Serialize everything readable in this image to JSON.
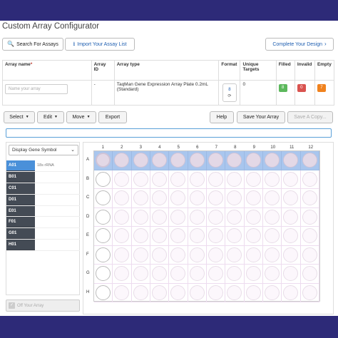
{
  "app": {
    "title": "Custom Array Configurator"
  },
  "top_actions": {
    "search_label": "Search For Assays",
    "import_label": "Import Your Assay List",
    "complete_label": "Complete Your Design"
  },
  "array_table": {
    "headers": [
      "Array name",
      "Array ID",
      "Array type",
      "Format",
      "Unique Targets",
      "Filled",
      "Invalid",
      "Empty"
    ],
    "array_name_placeholder": "Name your array",
    "array_id": "-",
    "array_type": "TaqMan Gene Expression Array Plate 0.2mL (Standard)",
    "format_value": "8",
    "unique_targets": "0",
    "filled": "8",
    "invalid": "0",
    "empty": "7",
    "colors": {
      "filled": "#5cb85c",
      "invalid": "#d9534f",
      "empty": "#f0821e"
    }
  },
  "toolbar": {
    "select_label": "Select",
    "edit_label": "Edit",
    "move_label": "Move",
    "export_label": "Export",
    "help_label": "Help",
    "save_label": "Save Your Array",
    "save_copy_label": "Save A Copy..."
  },
  "left_panel": {
    "display_select": "Display Gene Symbol",
    "rows": [
      {
        "label": "A01",
        "value": "18s rRNA"
      },
      {
        "label": "B01",
        "value": ""
      },
      {
        "label": "C01",
        "value": ""
      },
      {
        "label": "D01",
        "value": ""
      },
      {
        "label": "E01",
        "value": ""
      },
      {
        "label": "F01",
        "value": ""
      },
      {
        "label": "G01",
        "value": ""
      },
      {
        "label": "H01",
        "value": ""
      }
    ],
    "diff_button": "Off Your Array"
  },
  "plate": {
    "columns": [
      "1",
      "2",
      "3",
      "4",
      "5",
      "6",
      "7",
      "8",
      "9",
      "10",
      "11",
      "12"
    ],
    "rows": [
      "A",
      "B",
      "C",
      "D",
      "E",
      "F",
      "G",
      "H"
    ],
    "selected_row": "A"
  },
  "colors": {
    "accent": "#1e5eb0",
    "frame": "#2d2a78",
    "selected_row": "#a9c6ee"
  }
}
